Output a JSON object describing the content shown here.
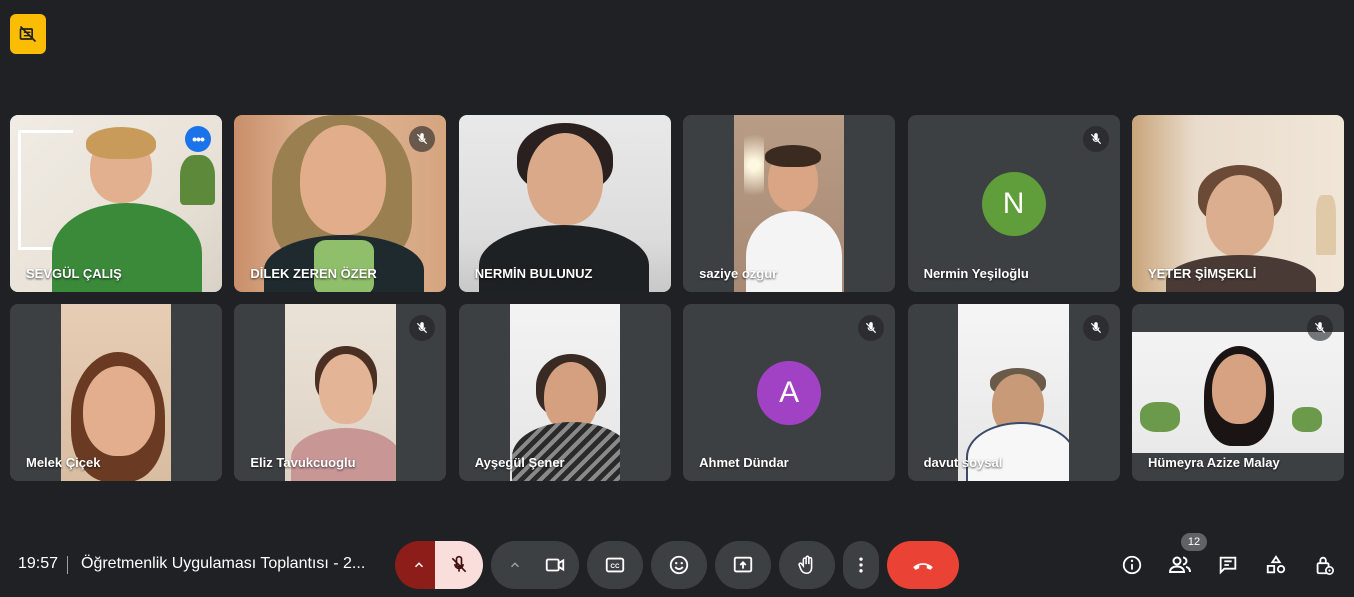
{
  "top_indicator": {
    "icon": "no-recording-icon",
    "color": "#fbbc04"
  },
  "participants": [
    {
      "name": "SEVGÜL ÇALIŞ",
      "muted": false,
      "active": true,
      "more_icon": "more-options-icon"
    },
    {
      "name": "DİLEK ZEREN ÖZER",
      "muted": true
    },
    {
      "name": "NERMİN BULUNUZ",
      "muted": false
    },
    {
      "name": "saziye ozgur",
      "muted": false
    },
    {
      "name": "Nermin Yeşiloğlu",
      "muted": true,
      "avatar_letter": "N",
      "avatar_color": "#5f9e3a"
    },
    {
      "name": "YETER ŞİMŞEKLİ",
      "muted": false
    },
    {
      "name": "Melek Çiçek",
      "muted": false
    },
    {
      "name": "Eliz Tavukcuoglu",
      "muted": true
    },
    {
      "name": "Ayşegül Şener",
      "muted": false
    },
    {
      "name": "Ahmet Dündar",
      "muted": true,
      "avatar_letter": "A",
      "avatar_color": "#a142c5"
    },
    {
      "name": "davut soysal",
      "muted": true
    },
    {
      "name": "Hümeyra Azize Malay",
      "muted": true
    }
  ],
  "footer": {
    "time": "19:57",
    "meeting_title": "Öğretmenlik Uygulaması Toplantısı - 2...",
    "participant_count": "12",
    "end_call_color": "#ea4335",
    "mic_muted_color": "#f9dedc"
  },
  "icons": {
    "mic": "mic-off-icon",
    "camera": "camera-icon",
    "captions": "captions-icon",
    "emoji": "emoji-icon",
    "present": "present-icon",
    "hand": "raise-hand-icon",
    "more": "more-vert-icon",
    "end": "end-call-icon",
    "info": "info-icon",
    "people": "people-icon",
    "chat": "chat-icon",
    "activities": "activities-icon",
    "lock": "host-controls-icon"
  }
}
